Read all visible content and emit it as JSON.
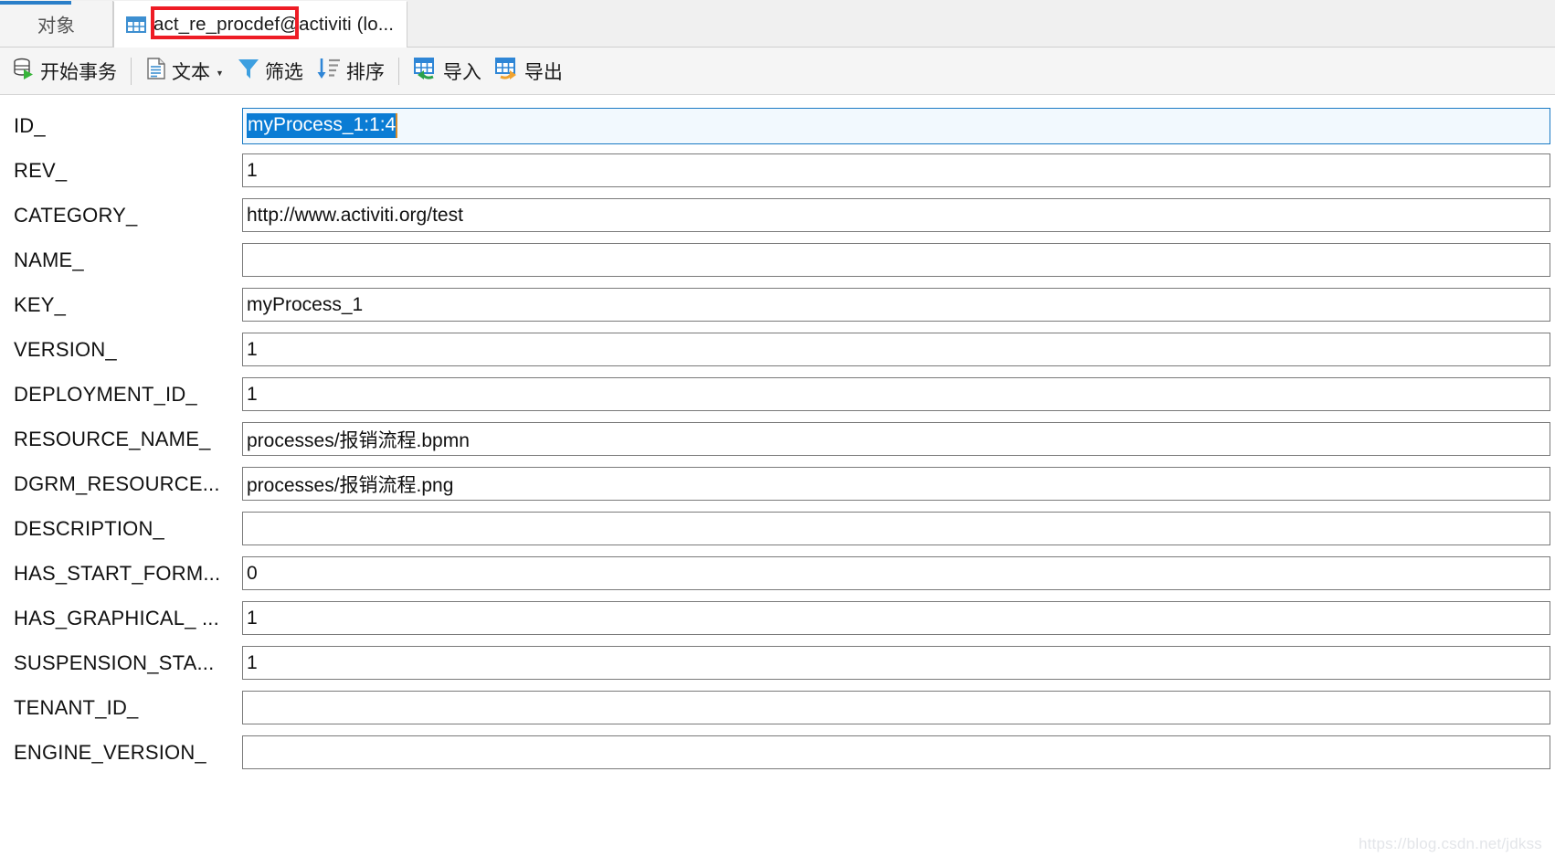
{
  "window": {
    "accent_color": "#2a7fc9",
    "annotation_color": "#ee1c25"
  },
  "tabs": [
    {
      "label": "对象",
      "icon": "objects-icon",
      "active": false
    },
    {
      "label": "act_re_procdef",
      "suffix": " @activiti (lo...",
      "icon": "table-icon",
      "active": true
    }
  ],
  "tab_active": {
    "table_name": "act_re_procdef",
    "connection": "@activiti (lo..."
  },
  "toolbar": {
    "items": [
      {
        "label": "开始事务",
        "icon": "begin-transaction-icon",
        "caret": false
      },
      {
        "label": "文本",
        "icon": "text-document-icon",
        "caret": true
      },
      {
        "label": "筛选",
        "icon": "filter-funnel-icon",
        "caret": false
      },
      {
        "label": "排序",
        "icon": "sort-descending-icon",
        "caret": false
      },
      {
        "label": "导入",
        "icon": "import-icon",
        "caret": false
      },
      {
        "label": "导出",
        "icon": "export-icon",
        "caret": false
      }
    ]
  },
  "form": {
    "rows": [
      {
        "label": "ID_",
        "value": "myProcess_1:1:4",
        "focused": true,
        "selected": true
      },
      {
        "label": "REV_",
        "value": "1",
        "focused": false,
        "selected": false
      },
      {
        "label": "CATEGORY_",
        "value": "http://www.activiti.org/test",
        "focused": false,
        "selected": false
      },
      {
        "label": "NAME_",
        "value": "",
        "focused": false,
        "selected": false
      },
      {
        "label": "KEY_",
        "value": "myProcess_1",
        "focused": false,
        "selected": false
      },
      {
        "label": "VERSION_",
        "value": "1",
        "focused": false,
        "selected": false
      },
      {
        "label": "DEPLOYMENT_ID_",
        "value": "1",
        "focused": false,
        "selected": false
      },
      {
        "label": "RESOURCE_NAME_",
        "value": "processes/报销流程.bpmn",
        "focused": false,
        "selected": false
      },
      {
        "label": "DGRM_RESOURCE...",
        "value": "processes/报销流程.png",
        "focused": false,
        "selected": false
      },
      {
        "label": "DESCRIPTION_",
        "value": "",
        "focused": false,
        "selected": false
      },
      {
        "label": "HAS_START_FORM...",
        "value": "0",
        "focused": false,
        "selected": false
      },
      {
        "label": "HAS_GRAPHICAL_ ...",
        "value": "1",
        "focused": false,
        "selected": false
      },
      {
        "label": "SUSPENSION_STA...",
        "value": "1",
        "focused": false,
        "selected": false
      },
      {
        "label": "TENANT_ID_",
        "value": "",
        "focused": false,
        "selected": false
      },
      {
        "label": "ENGINE_VERSION_",
        "value": "",
        "focused": false,
        "selected": false
      }
    ]
  },
  "watermark": {
    "text": "https://blog.csdn.net/jdkss"
  }
}
